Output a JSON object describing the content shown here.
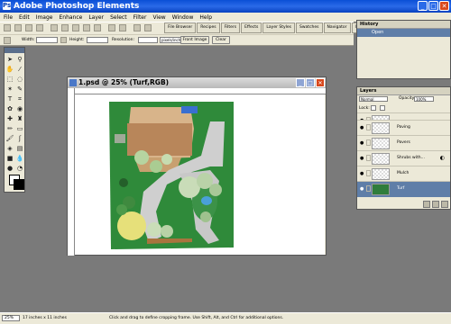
{
  "app": {
    "title": "Adobe Photoshop Elements"
  },
  "menu": [
    "File",
    "Edit",
    "Image",
    "Enhance",
    "Layer",
    "Select",
    "Filter",
    "View",
    "Window",
    "Help"
  ],
  "palette_well": [
    "File Browser",
    "Recipes",
    "Filters",
    "Effects",
    "Layer Styles",
    "Swatches",
    "Navigator",
    "Info"
  ],
  "options": {
    "width_label": "Width:",
    "height_label": "Height:",
    "resolution_label": "Resolution:",
    "resolution_unit": "pixels/inch",
    "front_image": "Front Image",
    "clear": "Clear"
  },
  "document": {
    "title": "1.psd @ 25% (Turf,RGB)"
  },
  "history": {
    "title": "History",
    "item": "Open"
  },
  "layers": {
    "title": "Layers",
    "mode": "Normal",
    "opacity_label": "Opacity:",
    "opacity": "100%",
    "lock_label": "Lock:",
    "items": [
      {
        "name": ""
      },
      {
        "name": "Paving"
      },
      {
        "name": "Pavers"
      },
      {
        "name": "Shrubs with..."
      },
      {
        "name": "Mulch"
      },
      {
        "name": "Turf"
      }
    ]
  },
  "status": {
    "zoom": "25%",
    "doc_info": "17 inches x 11 inches",
    "hint": "Click and drag to define cropping frame. Use Shift, Alt, and Ctrl for additional options."
  },
  "colors": {
    "title_blue": "#0a4fd6",
    "chrome": "#ece9d8",
    "workspace": "#7a7a7a",
    "turf": "#2f8a3a"
  }
}
